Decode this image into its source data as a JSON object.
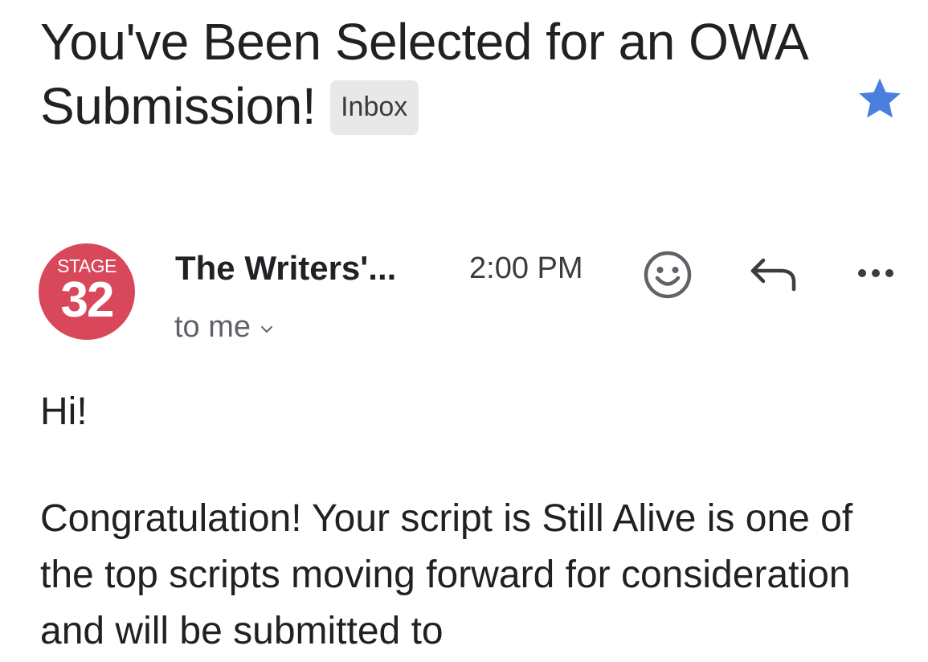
{
  "email": {
    "subject": "You've Been Selected for an OWA Submission!",
    "label": "Inbox",
    "starred": true,
    "star_color": "#4285f4"
  },
  "sender": {
    "avatar_top_text": "STAGE",
    "avatar_number": "32",
    "avatar_color": "#d8485a",
    "name": "The Writers'...",
    "time": "2:00 PM",
    "recipient": "to me"
  },
  "actions": {
    "emoji_icon": "emoji-reaction-icon",
    "reply_icon": "reply-icon",
    "more_icon": "more-options-icon"
  },
  "body": {
    "greeting": "Hi!",
    "paragraph": "Congratulation! Your script is Still Alive is one of the top scripts moving forward for consideration and will be submitted to"
  }
}
